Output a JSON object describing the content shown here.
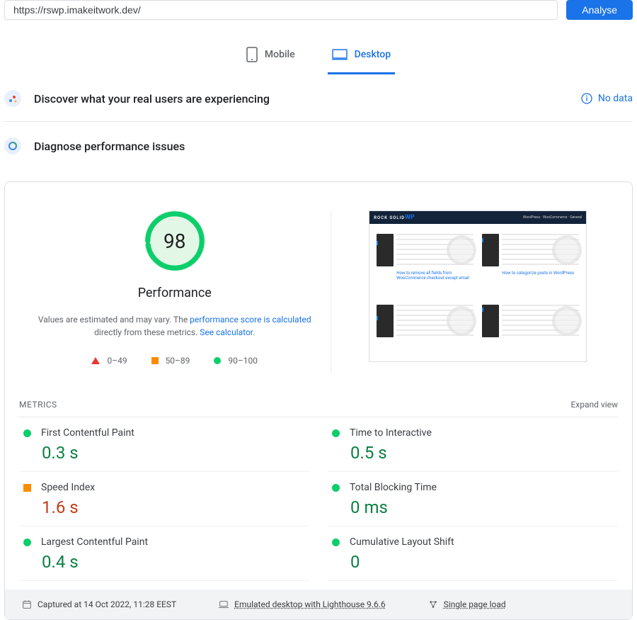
{
  "input": {
    "url": "https://rswp.imakeitwork.dev/",
    "analyse_label": "Analyse"
  },
  "tabs": {
    "mobile": "Mobile",
    "desktop": "Desktop"
  },
  "discover": {
    "title": "Discover what your real users are experiencing",
    "nodata": "No data"
  },
  "diagnose": {
    "title": "Diagnose performance issues"
  },
  "gauge": {
    "score": "98",
    "title": "Performance",
    "desc_pre": "Values are estimated and may vary. The ",
    "desc_link1": "performance score is calculated",
    "desc_mid": " directly from these metrics. ",
    "desc_link2": "See calculator",
    "desc_post": "."
  },
  "legend": {
    "r1": "0–49",
    "r2": "50–89",
    "r3": "90–100"
  },
  "screenshot": {
    "logo_a": "ROCK SOLID",
    "logo_b": "WP",
    "card1": "How to remove all fields from WooCommerce checkout except email",
    "card2": "How to categorize posts in WordPress"
  },
  "metrics_header": {
    "title": "METRICS",
    "expand": "Expand view"
  },
  "metrics": [
    {
      "label": "First Contentful Paint",
      "value": "0.3 s",
      "status": "green",
      "shape": "dot"
    },
    {
      "label": "Time to Interactive",
      "value": "0.5 s",
      "status": "green",
      "shape": "dot"
    },
    {
      "label": "Speed Index",
      "value": "1.6 s",
      "status": "orange",
      "shape": "sq"
    },
    {
      "label": "Total Blocking Time",
      "value": "0 ms",
      "status": "green",
      "shape": "dot"
    },
    {
      "label": "Largest Contentful Paint",
      "value": "0.4 s",
      "status": "green",
      "shape": "dot"
    },
    {
      "label": "Cumulative Layout Shift",
      "value": "0",
      "status": "green",
      "shape": "dot"
    }
  ],
  "footer": {
    "captured": "Captured at 14 Oct 2022, 11:28 EEST",
    "emulated": "Emulated desktop with Lighthouse 9.6.6",
    "load": "Single page load"
  }
}
